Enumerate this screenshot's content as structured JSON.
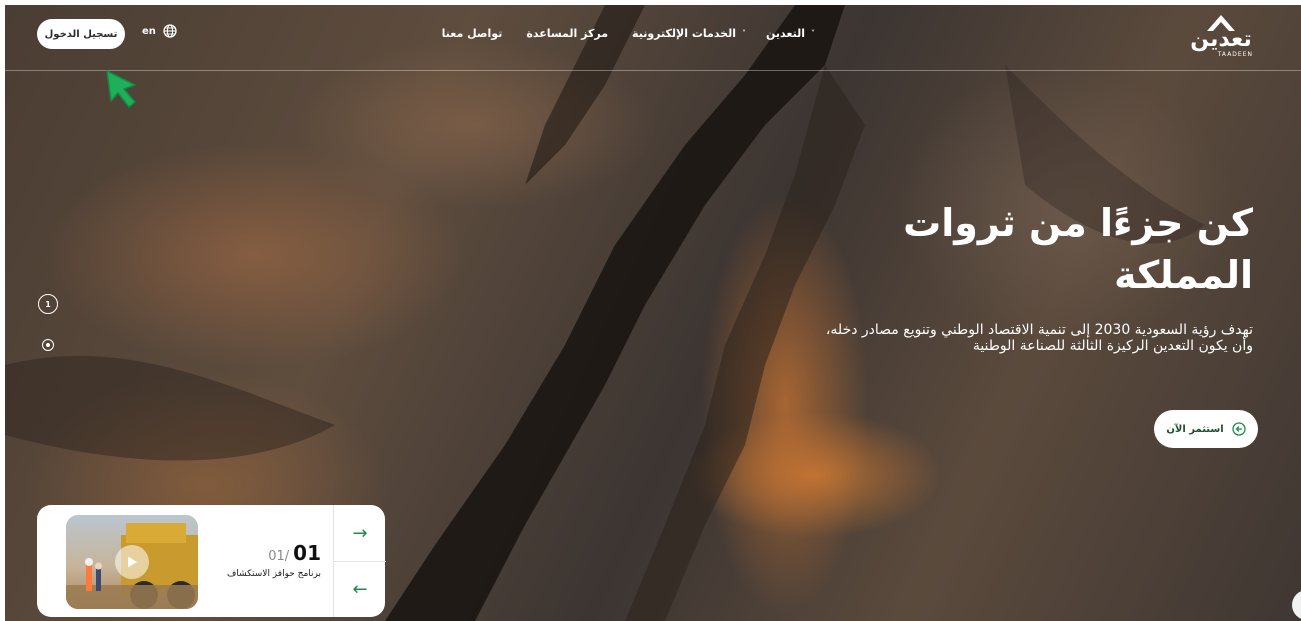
{
  "header": {
    "logo_ar": "تعدين",
    "logo_en": "TAADEEN",
    "nav": [
      {
        "label": "التعدين",
        "has_dropdown": true
      },
      {
        "label": "الخدمات الإلكترونية",
        "has_dropdown": true
      },
      {
        "label": "مركز المساعدة",
        "has_dropdown": false
      },
      {
        "label": "تواصل معنا",
        "has_dropdown": false
      }
    ],
    "chevron": "˅",
    "language": "en",
    "language_icon": "globe-icon",
    "login_label": "تسجيل الدخول"
  },
  "hero": {
    "title": "كن جزءًا من ثروات المملكة",
    "subtitle": "تهدف رؤية السعودية 2030 إلى تنمية الاقتصاد الوطني وتنويع مصادر دخله، وأن يكون التعدين الركيزة الثالثة للصناعة الوطنية",
    "cta_label": "استثمر الآن",
    "cta_icon": "arrow-circle-icon"
  },
  "slider": {
    "current_page": "1"
  },
  "card": {
    "current": "01",
    "total": "01/",
    "caption": "برنامج حوافز الاستكشاف",
    "next_arrow": "→",
    "prev_arrow": "←",
    "thumb_icon": "play-icon"
  },
  "colors": {
    "accent_green": "#1f8a4c",
    "cursor_green": "#1fae5a",
    "text_white": "#ffffff"
  }
}
